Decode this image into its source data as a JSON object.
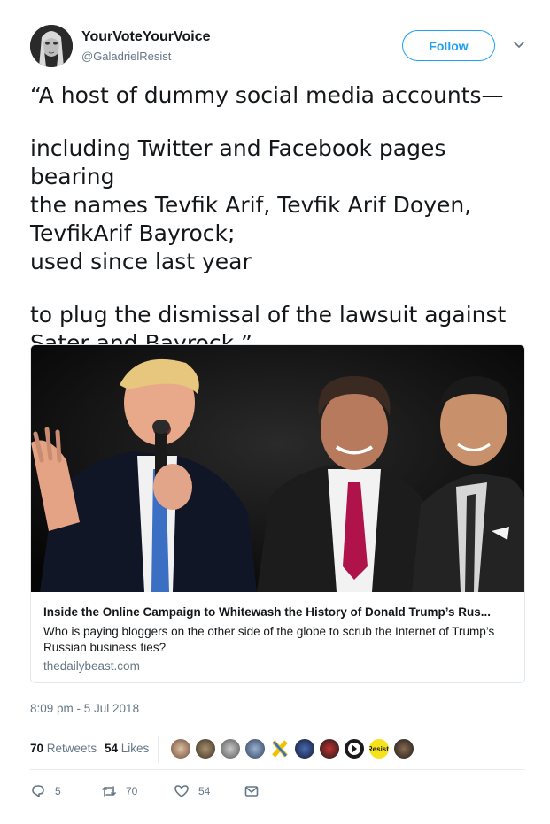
{
  "author": {
    "display_name": "YourVoteYourVoice",
    "handle": "@GaladrielResist"
  },
  "follow_label": "Follow",
  "tweet": {
    "paragraph_1": "“A host of dummy social media accounts—",
    "paragraph_2": "including Twitter and Facebook pages bearing\nthe names Tevfik Arif, Tevfik Arif Doyen,\nTevfikArif Bayrock;\nused since last year",
    "paragraph_3": "to plug the dismissal of the lawsuit against\nSater and Bayrock.”"
  },
  "card": {
    "title": "Inside the Online Campaign to Whitewash the History of Donald Trump’s Rus...",
    "description": "Who is paying bloggers on the other side of the globe to scrub the Internet of Trump’s Russian business ties?",
    "domain": "thedailybeast.com"
  },
  "timestamp": "8:09 pm - 5 Jul 2018",
  "stats": {
    "retweets_count": "70",
    "retweets_label": "Retweets",
    "likes_count": "54",
    "likes_label": "Likes"
  },
  "liker_badge_text": "Resist.",
  "actions": {
    "reply_count": "5",
    "retweet_count": "70",
    "like_count": "54"
  },
  "colors": {
    "accent": "#1da1f2",
    "secondary_text": "#657786",
    "primary_text": "#14171a"
  }
}
